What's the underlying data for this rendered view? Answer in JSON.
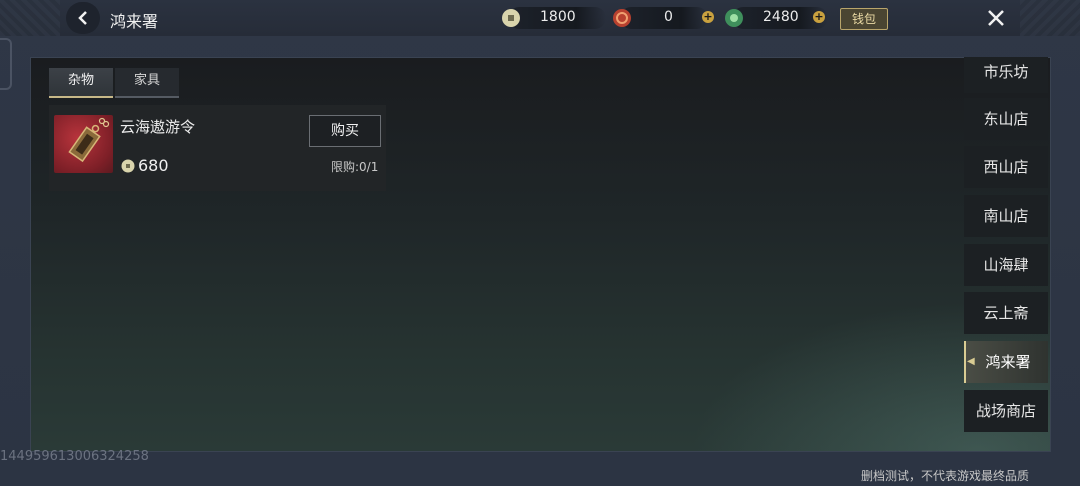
{
  "header": {
    "title": "鸿来署",
    "back_icon": "chevron-left-icon",
    "close_icon": "close-icon"
  },
  "currencies": [
    {
      "name": "silver-coin",
      "value": "1800",
      "color": "#d7d2a8"
    },
    {
      "name": "red-token",
      "value": "0",
      "color": "#b8412f"
    },
    {
      "name": "jade-coin",
      "value": "2480",
      "color": "#4aa46a"
    }
  ],
  "wallet_label": "钱包",
  "tabs": [
    {
      "label": "杂物",
      "active": true
    },
    {
      "label": "家具",
      "active": false
    }
  ],
  "items": [
    {
      "name": "云海遨游令",
      "buy_label": "购买",
      "price": "680",
      "limit": "限购:0/1"
    }
  ],
  "shops": [
    {
      "label": "市乐坊"
    },
    {
      "label": "东山店"
    },
    {
      "label": "西山店"
    },
    {
      "label": "南山店"
    },
    {
      "label": "山海肆"
    },
    {
      "label": "云上斋"
    },
    {
      "label": "鸿来署",
      "active": true
    },
    {
      "label": "战场商店"
    }
  ],
  "uid": "144959613006324258",
  "disclaimer": "删档测试，不代表游戏最终品质",
  "colors": {
    "accent": "#d9cc93",
    "panel": "#1f2628"
  }
}
